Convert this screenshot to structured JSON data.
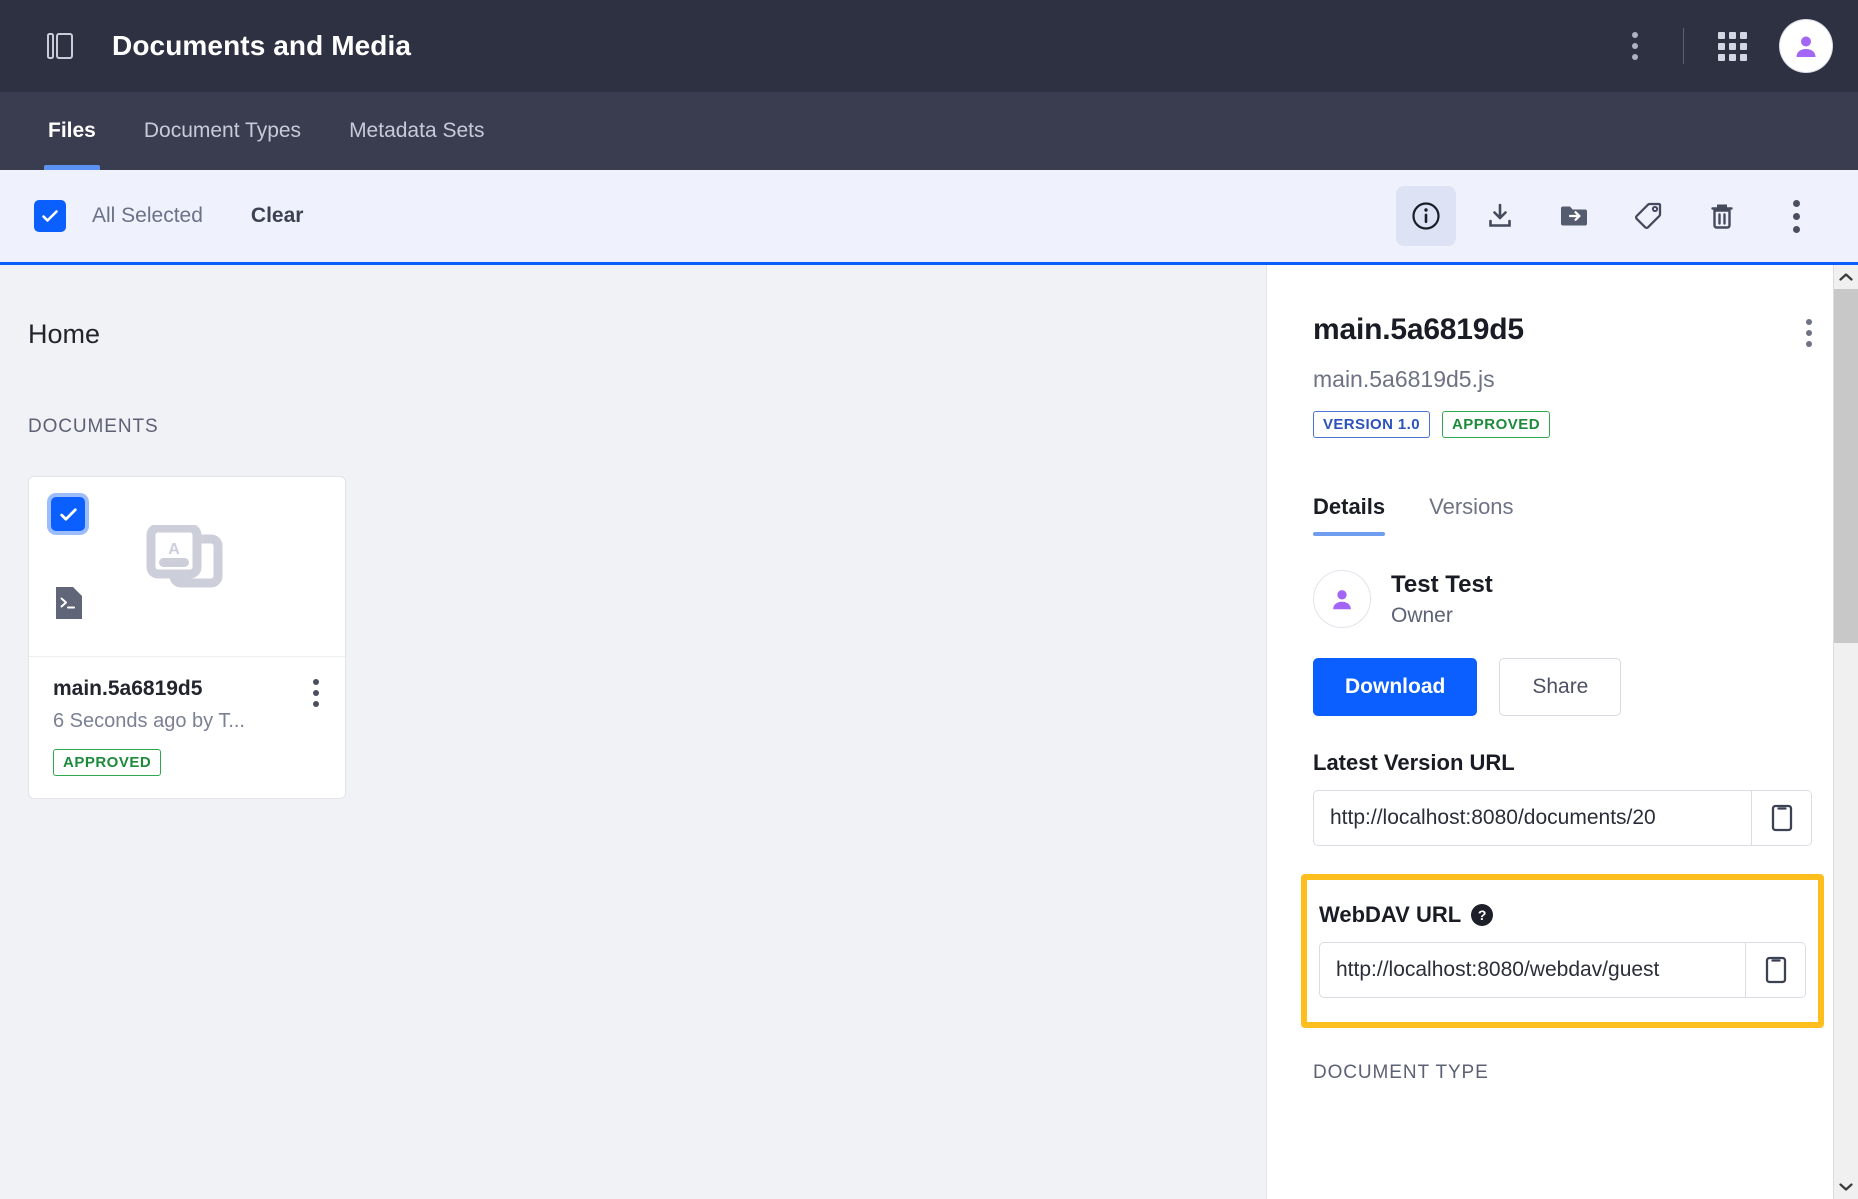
{
  "header": {
    "title": "Documents and Media",
    "sidebar_toggle_icon": "panel-toggle-icon",
    "kebab_icon": "kebab-menu-icon",
    "apps_icon": "apps-grid-icon",
    "avatar_icon": "user-avatar-icon"
  },
  "nav": {
    "tabs": [
      {
        "label": "Files",
        "active": true
      },
      {
        "label": "Document Types",
        "active": false
      },
      {
        "label": "Metadata Sets",
        "active": false
      }
    ]
  },
  "selection_toolbar": {
    "checkbox_checked": true,
    "selected_label": "All Selected",
    "clear_label": "Clear",
    "actions": [
      {
        "name": "info-icon",
        "active": true
      },
      {
        "name": "download-icon",
        "active": false
      },
      {
        "name": "move-to-folder-icon",
        "active": false
      },
      {
        "name": "tag-icon",
        "active": false
      },
      {
        "name": "trash-icon",
        "active": false
      },
      {
        "name": "kebab-menu-icon",
        "active": false
      }
    ]
  },
  "main": {
    "breadcrumb": "Home",
    "section_label": "DOCUMENTS",
    "cards": [
      {
        "title": "main.5a6819d5",
        "subtitle": "6 Seconds ago by T...",
        "status": "APPROVED",
        "checked": true,
        "thumb_icon": "document-image-icon",
        "type_badge_icon": "script-file-icon"
      }
    ]
  },
  "side_panel": {
    "title": "main.5a6819d5",
    "filename": "main.5a6819d5.js",
    "version_badge": "VERSION 1.0",
    "status_badge": "APPROVED",
    "kebab_icon": "kebab-menu-icon",
    "tabs": [
      {
        "label": "Details",
        "active": true
      },
      {
        "label": "Versions",
        "active": false
      }
    ],
    "owner": {
      "name": "Test Test",
      "role": "Owner",
      "avatar_icon": "user-avatar-icon"
    },
    "buttons": {
      "download": "Download",
      "share": "Share"
    },
    "latest_version": {
      "label": "Latest Version URL",
      "value": "http://localhost:8080/documents/20",
      "copy_icon": "copy-icon"
    },
    "webdav": {
      "label": "WebDAV URL",
      "help_icon": "help-question-icon",
      "value": "http://localhost:8080/webdav/guest",
      "copy_icon": "copy-icon",
      "highlight_color": "#FDBE1E"
    },
    "document_type_label": "DOCUMENT TYPE"
  },
  "colors": {
    "header_bg": "#2E3142",
    "nav_bg": "#393D4F",
    "toolbar_bg": "#EFF2FD",
    "accent_blue": "#0b5fff",
    "approved_green": "#1d8a3c",
    "highlight_yellow": "#FDBE1E"
  }
}
